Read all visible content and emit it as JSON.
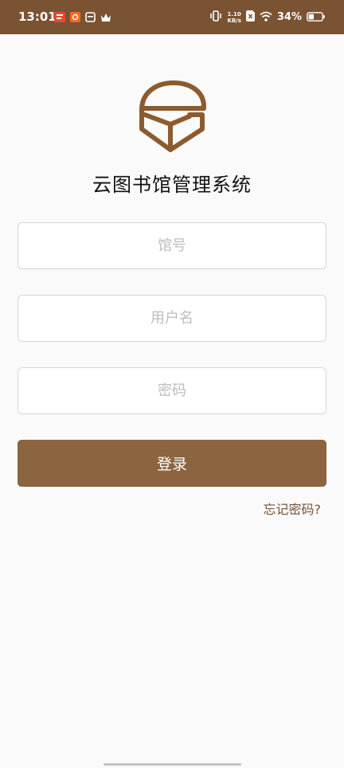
{
  "status_bar": {
    "time": "13:01",
    "net_speed_value": "1.10",
    "net_speed_unit": "KB/s",
    "battery": "34%"
  },
  "app": {
    "title": "云图书馆管理系统"
  },
  "form": {
    "library_no_placeholder": "馆号",
    "username_placeholder": "用户名",
    "password_placeholder": "密码",
    "login_label": "登录",
    "forgot_label": "忘记密码?"
  },
  "colors": {
    "brand": "#8c6440",
    "status_bar": "#7a5333"
  }
}
